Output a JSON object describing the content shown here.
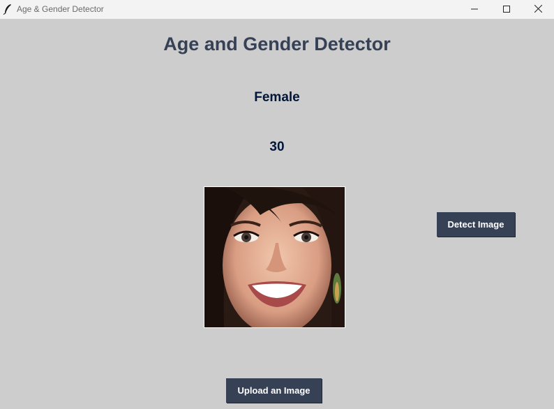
{
  "window": {
    "title": "Age & Gender Detector",
    "icon": "feather-icon",
    "controls": [
      "minimize-icon",
      "maximize-icon",
      "close-icon"
    ]
  },
  "heading": "Age and Gender Detector",
  "prediction": {
    "gender": "Female",
    "age": "30"
  },
  "image": {
    "description": "smiling-woman-face-photo"
  },
  "buttons": {
    "detect": "Detect Image",
    "upload": "Upload an Image"
  },
  "colors": {
    "background": "#cdcdcd",
    "heading": "#364156",
    "result_text": "#011638",
    "button_bg": "#364156",
    "button_text": "#ffffff"
  }
}
